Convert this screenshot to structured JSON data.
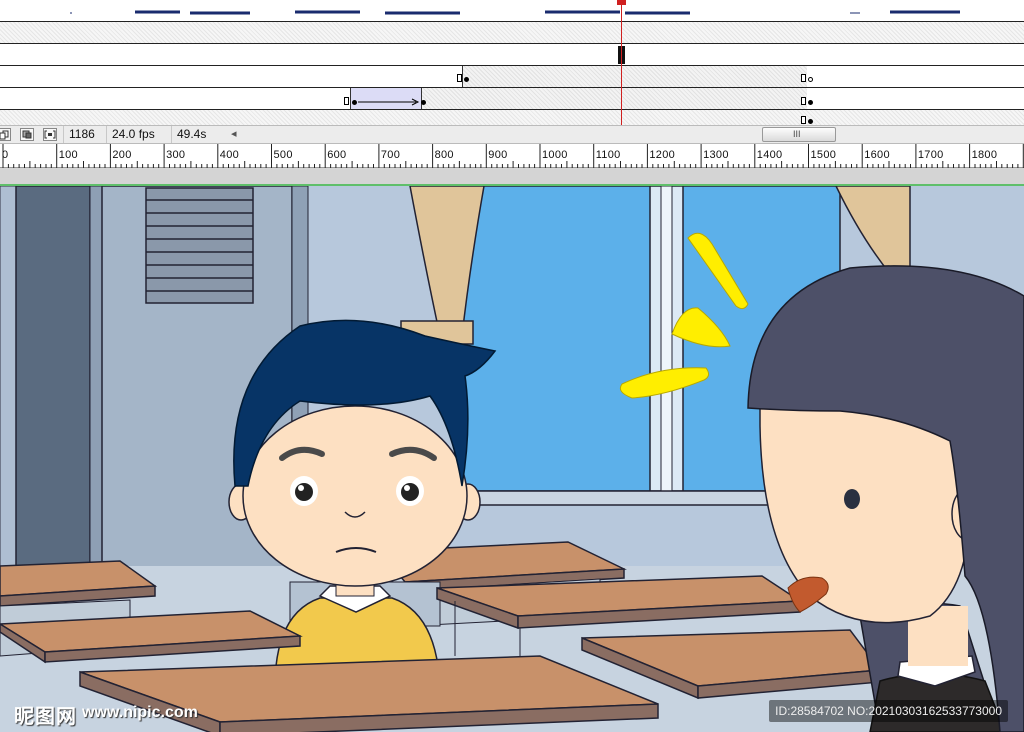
{
  "toolbar": {
    "frame_number": "1186",
    "frame_rate": "24.0 fps",
    "elapsed_time": "49.4s",
    "scroll_left_arrow": "◂",
    "scroll_thumb_grip": "III"
  },
  "ruler": {
    "ticks": [
      "0",
      "100",
      "200",
      "300",
      "400",
      "500",
      "600",
      "700",
      "800",
      "900",
      "1000",
      "1100",
      "1200",
      "1300",
      "1400",
      "1500",
      "1600",
      "1700",
      "1800"
    ]
  },
  "watermark": {
    "logo_text": "昵图网",
    "site": "www.nipic.com",
    "id_text": "ID:28584702 NO:20210303162533773000"
  },
  "colors": {
    "playhead": "#d02020",
    "sky": "#5cb0ea",
    "wall": "#b7c8dc",
    "door": "#a4b5c8",
    "desk_top": "#c8916a",
    "hair_boy": "#073466",
    "hair_girl": "#4d5068",
    "shirt": "#f2c94c",
    "skin": "#fde0c2",
    "spark": "#ffee00"
  }
}
